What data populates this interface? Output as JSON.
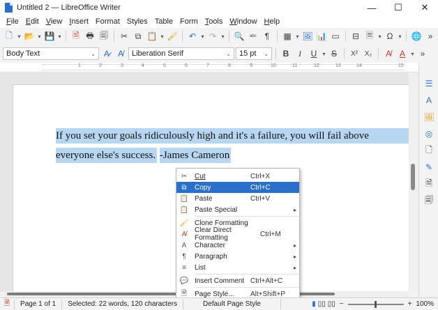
{
  "window": {
    "title": "Untitled 2 — LibreOffice Writer",
    "minimize_glyph": "—",
    "maximize_glyph": "☐",
    "close_glyph": "✕"
  },
  "menu": [
    {
      "key": "file",
      "first": "F",
      "rest": "ile"
    },
    {
      "key": "edit",
      "first": "E",
      "rest": "dit"
    },
    {
      "key": "view",
      "first": "V",
      "rest": "iew"
    },
    {
      "key": "insert",
      "first": "I",
      "rest": "nsert"
    },
    {
      "key": "format",
      "first": "Fo",
      "rest": "rmat",
      "underline_index": 1
    },
    {
      "key": "styles",
      "first": "St",
      "rest": "yles",
      "underline_index": 1
    },
    {
      "key": "table",
      "first": "T",
      "rest": "able",
      "underline_index": 1
    },
    {
      "key": "form",
      "first": "Fo",
      "rest": "rm",
      "underline_index": 2
    },
    {
      "key": "tools",
      "first": "T",
      "rest": "ools"
    },
    {
      "key": "window",
      "first": "W",
      "rest": "indow"
    },
    {
      "key": "help",
      "first": "H",
      "rest": "elp"
    }
  ],
  "formatting": {
    "paragraph_style": "Body Text",
    "font_name": "Liberation Serif",
    "font_size": "15 pt",
    "bold": "B",
    "italic": "I",
    "underline": "U",
    "strike": "S",
    "superscript": "X²",
    "subscript": "X₂"
  },
  "ruler_numbers": [
    "1",
    "2",
    "3",
    "4",
    "5",
    "6",
    "7",
    "8",
    "9",
    "10",
    "11",
    "12",
    "13",
    "14",
    "15"
  ],
  "document": {
    "line1": "If you set your goals ridiculously high and it's a failure, you will fail above",
    "line2": "everyone else's success.",
    "line3": "-James Cameron",
    "selection_color": "#b7d6f1"
  },
  "context_menu": {
    "items": [
      {
        "label": "Cut",
        "shortcut": "Ctrl+X",
        "icon": "scissors-icon",
        "glyph": "✂"
      },
      {
        "label": "Copy",
        "shortcut": "Ctrl+C",
        "icon": "copy-icon",
        "glyph": "⧉",
        "highlighted": true
      },
      {
        "label": "Paste",
        "shortcut": "Ctrl+V",
        "icon": "paste-icon",
        "glyph": "📋"
      },
      {
        "label": "Paste Special",
        "shortcut": "",
        "icon": "paste-special-icon",
        "glyph": "📋",
        "submenu": true
      },
      {
        "label": "Clone Formatting",
        "shortcut": "",
        "icon": "clone-formatting-icon",
        "glyph": "🖌"
      },
      {
        "label": "Clear Direct Formatting",
        "shortcut": "Ctrl+M",
        "icon": "clear-formatting-icon",
        "glyph": "A̸"
      },
      {
        "label": "Character",
        "shortcut": "",
        "icon": "character-icon",
        "glyph": "A",
        "submenu": true
      },
      {
        "label": "Paragraph",
        "shortcut": "",
        "icon": "paragraph-icon",
        "glyph": "¶",
        "submenu": true
      },
      {
        "label": "List",
        "shortcut": "",
        "icon": "list-icon",
        "glyph": "≡",
        "submenu": true
      },
      {
        "label": "Insert Comment",
        "shortcut": "Ctrl+Alt+C",
        "icon": "comment-icon",
        "glyph": "💬"
      },
      {
        "label": "Page Style...",
        "shortcut": "Alt+Shift+P",
        "icon": "page-style-icon",
        "glyph": "🗎"
      }
    ],
    "highlight_color": "#2a6fc9"
  },
  "status": {
    "page": "Page 1 of 1",
    "selection": "Selected: 22 words, 120 characters",
    "page_style": "Default Page Style",
    "zoom": "100%",
    "zoom_minus": "−",
    "zoom_plus": "+"
  },
  "accent_color": "#2a6fc9"
}
